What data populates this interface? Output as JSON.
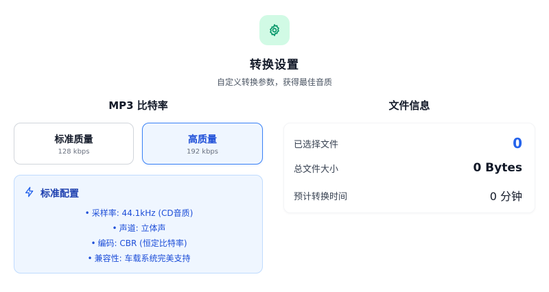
{
  "header": {
    "icon": "gear-icon",
    "title": "转换设置",
    "subtitle": "自定义转换参数，获得最佳音质"
  },
  "bitrate": {
    "title": "MP3 比特率",
    "options": [
      {
        "label": "标准质量",
        "kbps": "128 kbps",
        "selected": false
      },
      {
        "label": "高质量",
        "kbps": "192 kbps",
        "selected": true
      }
    ]
  },
  "config": {
    "icon": "lightning-icon",
    "title": "标准配置",
    "items": [
      "采样率: 44.1kHz (CD音质)",
      "声道: 立体声",
      "编码: CBR (恒定比特率)",
      "兼容性: 车载系统完美支持"
    ]
  },
  "file_info": {
    "title": "文件信息",
    "rows": [
      {
        "label": "已选择文件",
        "value": "0"
      },
      {
        "label": "总文件大小",
        "value": "0 Bytes"
      },
      {
        "label": "预计转换时间",
        "value": "0 分钟"
      }
    ]
  },
  "colors": {
    "accent": "#2563eb",
    "icon_bg": "#d1fae5",
    "icon_stroke": "#059669",
    "panel_bg": "#eff6ff"
  }
}
